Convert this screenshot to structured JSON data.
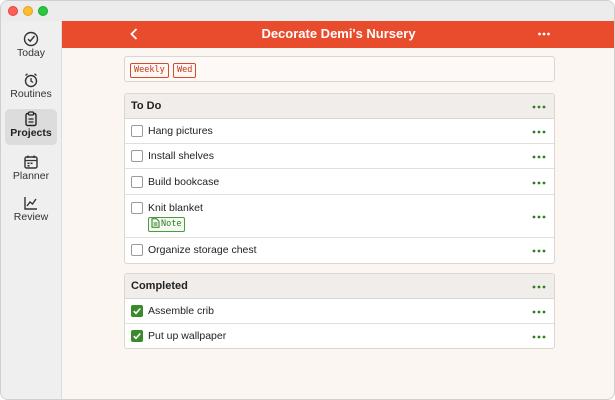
{
  "window": {
    "buttons": [
      "close",
      "minimize",
      "zoom"
    ]
  },
  "sidebar": {
    "items": [
      {
        "label": "Today",
        "icon": "check-circle-icon"
      },
      {
        "label": "Routines",
        "icon": "alarm-clock-icon"
      },
      {
        "label": "Projects",
        "icon": "clipboard-icon",
        "active": true
      },
      {
        "label": "Planner",
        "icon": "calendar-icon"
      },
      {
        "label": "Review",
        "icon": "line-chart-icon"
      }
    ]
  },
  "header": {
    "title": "Decorate Demi's Nursery",
    "back_icon": "chevron-left-icon",
    "more_icon": "ellipsis-icon",
    "color": "#e84c2c"
  },
  "tags": [
    "Weekly",
    "Wed"
  ],
  "todo": {
    "title": "To Do",
    "items": [
      {
        "label": "Hang pictures",
        "checked": false
      },
      {
        "label": "Install shelves",
        "checked": false
      },
      {
        "label": "Build bookcase",
        "checked": false
      },
      {
        "label": "Knit blanket",
        "checked": false,
        "note": "Note"
      },
      {
        "label": "Organize storage chest",
        "checked": false
      }
    ]
  },
  "completed": {
    "title": "Completed",
    "items": [
      {
        "label": "Assemble crib",
        "checked": true
      },
      {
        "label": "Put up wallpaper",
        "checked": true
      }
    ]
  },
  "colors": {
    "accent": "#e84c2c",
    "checked_green": "#3a8a2c",
    "dots_green": "#2f7d22"
  }
}
